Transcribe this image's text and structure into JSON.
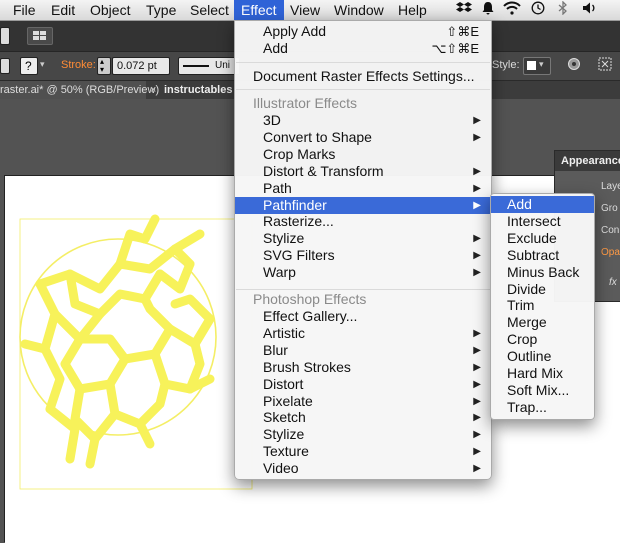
{
  "menubar": {
    "items": [
      "File",
      "Edit",
      "Object",
      "Type",
      "Select",
      "Effect",
      "View",
      "Window",
      "Help"
    ],
    "active": "Effect",
    "tray_icons": [
      "dropbox-icon",
      "bell-icon",
      "wifi-icon",
      "clock-icon",
      "bluetooth-icon",
      "volume-icon"
    ]
  },
  "control_bar": {
    "stroke_label": "Stroke:",
    "stroke_value": "0.072 pt",
    "stroke_style": "Uni",
    "style_label": "Style:"
  },
  "document_tabs": [
    "raster.ai* @ 50% (RGB/Preview)",
    "instructables"
  ],
  "appearance_panel": {
    "title": "Appearance",
    "rows": [
      "Laye",
      "Gro",
      "Con",
      "Opa"
    ],
    "fx_label": "fx"
  },
  "effect_menu": {
    "apply_label": "Apply Add",
    "apply_shortcut": "⇧⌘E",
    "add_label": "Add",
    "add_shortcut": "⌥⇧⌘E",
    "document_raster": "Document Raster Effects Settings...",
    "illustrator_header": "Illustrator Effects",
    "illustrator_items": [
      {
        "label": "3D",
        "submenu": true
      },
      {
        "label": "Convert to Shape",
        "submenu": true
      },
      {
        "label": "Crop Marks",
        "submenu": false
      },
      {
        "label": "Distort & Transform",
        "submenu": true
      },
      {
        "label": "Path",
        "submenu": true
      },
      {
        "label": "Pathfinder",
        "submenu": true
      },
      {
        "label": "Rasterize...",
        "submenu": false
      },
      {
        "label": "Stylize",
        "submenu": true
      },
      {
        "label": "SVG Filters",
        "submenu": true
      },
      {
        "label": "Warp",
        "submenu": true
      }
    ],
    "photoshop_header": "Photoshop Effects",
    "photoshop_items": [
      {
        "label": "Effect Gallery...",
        "submenu": false
      },
      {
        "label": "Artistic",
        "submenu": true
      },
      {
        "label": "Blur",
        "submenu": true
      },
      {
        "label": "Brush Strokes",
        "submenu": true
      },
      {
        "label": "Distort",
        "submenu": true
      },
      {
        "label": "Pixelate",
        "submenu": true
      },
      {
        "label": "Sketch",
        "submenu": true
      },
      {
        "label": "Stylize",
        "submenu": true
      },
      {
        "label": "Texture",
        "submenu": true
      },
      {
        "label": "Video",
        "submenu": true
      }
    ],
    "highlighted": "Pathfinder"
  },
  "pathfinder_submenu": {
    "items": [
      "Add",
      "Intersect",
      "Exclude",
      "Subtract",
      "Minus Back",
      "Divide",
      "Trim",
      "Merge",
      "Crop",
      "Outline",
      "Hard Mix",
      "Soft Mix...",
      "Trap..."
    ],
    "highlighted": "Add"
  },
  "colors": {
    "highlight": "#3a6ad8",
    "artwork": "#f7f25a"
  }
}
